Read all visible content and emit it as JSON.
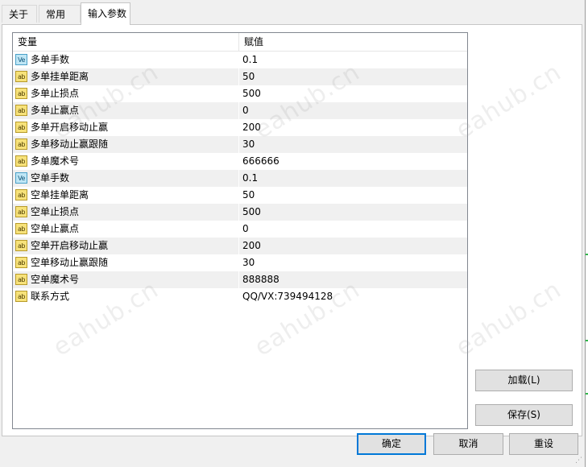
{
  "tabs": [
    {
      "label": "关于",
      "active": false
    },
    {
      "label": "常用",
      "active": false
    },
    {
      "label": "输入参数",
      "active": true
    }
  ],
  "table": {
    "headers": {
      "name": "变量",
      "value": "赋值"
    },
    "rows": [
      {
        "icon": "ve",
        "name": "多单手数",
        "value": "0.1"
      },
      {
        "icon": "ab",
        "name": "多单挂单距离",
        "value": "50"
      },
      {
        "icon": "ab",
        "name": "多单止损点",
        "value": "500"
      },
      {
        "icon": "ab",
        "name": "多单止赢点",
        "value": "0"
      },
      {
        "icon": "ab",
        "name": "多单开启移动止赢",
        "value": "200"
      },
      {
        "icon": "ab",
        "name": "多单移动止赢跟随",
        "value": "30"
      },
      {
        "icon": "ab",
        "name": "多单魔术号",
        "value": "666666"
      },
      {
        "icon": "ve",
        "name": "空单手数",
        "value": "0.1"
      },
      {
        "icon": "ab",
        "name": "空单挂单距离",
        "value": "50"
      },
      {
        "icon": "ab",
        "name": "空单止损点",
        "value": "500"
      },
      {
        "icon": "ab",
        "name": "空单止赢点",
        "value": "0"
      },
      {
        "icon": "ab",
        "name": "空单开启移动止赢",
        "value": "200"
      },
      {
        "icon": "ab",
        "name": "空单移动止赢跟随",
        "value": "30"
      },
      {
        "icon": "ab",
        "name": "空单魔术号",
        "value": "888888"
      },
      {
        "icon": "ab",
        "name": "联系方式",
        "value": "QQ/VX:739494128"
      }
    ]
  },
  "icons": {
    "ab": "ab",
    "ve": "Ve"
  },
  "watermark": "eahub.cn",
  "buttons": {
    "load": "加载(L)",
    "save": "保存(S)",
    "ok": "确定",
    "cancel": "取消",
    "reset": "重设"
  },
  "colors": {
    "accent": "#0078d7",
    "row_alt": "#f0f0f0",
    "icon_ab": "#f7e27a",
    "icon_ve": "#bfe6f5"
  }
}
